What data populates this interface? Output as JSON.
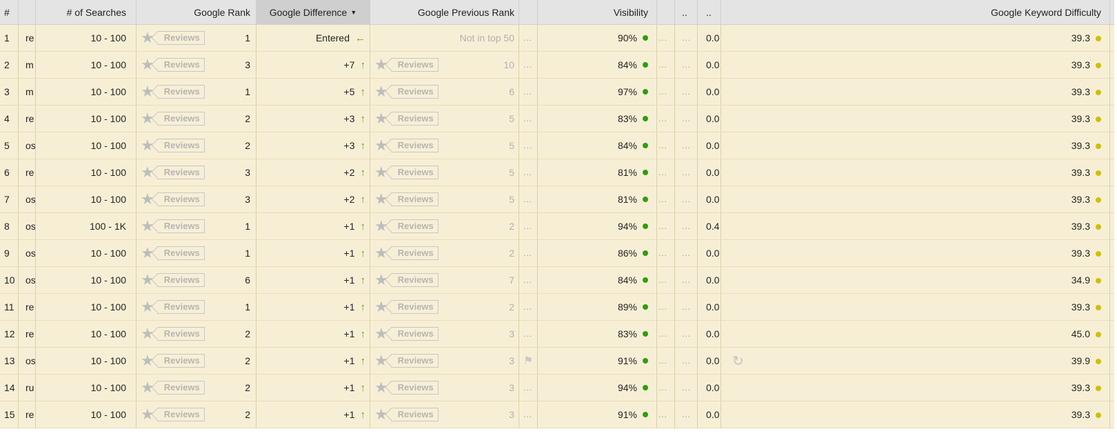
{
  "colors": {
    "green": "#2e9e12",
    "yellow": "#cdbf0c",
    "arrow": "#5aa026"
  },
  "headers": {
    "num": "#",
    "kw": "",
    "searches": "# of Searches",
    "rank": "Google Rank",
    "diff": "Google Difference",
    "prev": "Google Previous Rank",
    "x1": "",
    "vis": "Visibility",
    "x2": "",
    "x3": "..",
    "x4": "..",
    "difficulty": "Google Keyword Difficulty"
  },
  "reviews_label": "Reviews",
  "ellipsis": "...",
  "rows": [
    {
      "num": "1",
      "kw": "re",
      "searches": "10 - 100",
      "rank": "1",
      "diff": "Entered",
      "diff_icon": "arrow-left-icon",
      "prev": "Not in top 50",
      "vis": "90%",
      "vis_color": "green",
      "x4": "0.0",
      "kd": "39.3",
      "kd_color": "yellow"
    },
    {
      "num": "2",
      "kw": "m",
      "searches": "10 - 100",
      "rank": "3",
      "diff": "+7",
      "diff_icon": "arrow-up-icon",
      "prev": "10",
      "vis": "84%",
      "vis_color": "green",
      "x4": "0.0",
      "kd": "39.3",
      "kd_color": "yellow"
    },
    {
      "num": "3",
      "kw": "m",
      "searches": "10 - 100",
      "rank": "1",
      "diff": "+5",
      "diff_icon": "arrow-up-icon",
      "prev": "6",
      "vis": "97%",
      "vis_color": "green",
      "x4": "0.0",
      "kd": "39.3",
      "kd_color": "yellow"
    },
    {
      "num": "4",
      "kw": "re",
      "searches": "10 - 100",
      "rank": "2",
      "diff": "+3",
      "diff_icon": "arrow-up-icon",
      "prev": "5",
      "vis": "83%",
      "vis_color": "green",
      "x4": "0.0",
      "kd": "39.3",
      "kd_color": "yellow"
    },
    {
      "num": "5",
      "kw": "os",
      "searches": "10 - 100",
      "rank": "2",
      "diff": "+3",
      "diff_icon": "arrow-up-icon",
      "prev": "5",
      "vis": "84%",
      "vis_color": "green",
      "x4": "0.0",
      "kd": "39.3",
      "kd_color": "yellow"
    },
    {
      "num": "6",
      "kw": "re",
      "searches": "10 - 100",
      "rank": "3",
      "diff": "+2",
      "diff_icon": "arrow-up-icon",
      "prev": "5",
      "vis": "81%",
      "vis_color": "green",
      "x4": "0.0",
      "kd": "39.3",
      "kd_color": "yellow"
    },
    {
      "num": "7",
      "kw": "os",
      "searches": "10 - 100",
      "rank": "3",
      "diff": "+2",
      "diff_icon": "arrow-up-icon",
      "prev": "5",
      "vis": "81%",
      "vis_color": "green",
      "x4": "0.0",
      "kd": "39.3",
      "kd_color": "yellow"
    },
    {
      "num": "8",
      "kw": "os",
      "searches": "100 - 1K",
      "rank": "1",
      "diff": "+1",
      "diff_icon": "arrow-up-icon",
      "prev": "2",
      "vis": "94%",
      "vis_color": "green",
      "x4": "0.4",
      "kd": "39.3",
      "kd_color": "yellow"
    },
    {
      "num": "9",
      "kw": "os",
      "searches": "10 - 100",
      "rank": "1",
      "diff": "+1",
      "diff_icon": "arrow-up-icon",
      "prev": "2",
      "vis": "86%",
      "vis_color": "green",
      "x4": "0.0",
      "kd": "39.3",
      "kd_color": "yellow"
    },
    {
      "num": "10",
      "kw": "os",
      "searches": "10 - 100",
      "rank": "6",
      "diff": "+1",
      "diff_icon": "arrow-up-icon",
      "prev": "7",
      "vis": "84%",
      "vis_color": "green",
      "x4": "0.0",
      "kd": "34.9",
      "kd_color": "yellow"
    },
    {
      "num": "11",
      "kw": "re",
      "searches": "10 - 100",
      "rank": "1",
      "diff": "+1",
      "diff_icon": "arrow-up-icon",
      "prev": "2",
      "vis": "89%",
      "vis_color": "green",
      "x4": "0.0",
      "kd": "39.3",
      "kd_color": "yellow"
    },
    {
      "num": "12",
      "kw": "re",
      "searches": "10 - 100",
      "rank": "2",
      "diff": "+1",
      "diff_icon": "arrow-up-icon",
      "prev": "3",
      "vis": "83%",
      "vis_color": "green",
      "x4": "0.0",
      "kd": "45.0",
      "kd_color": "yellow"
    },
    {
      "num": "13",
      "kw": "os",
      "searches": "10 - 100",
      "rank": "2",
      "diff": "+1",
      "diff_icon": "arrow-up-icon",
      "prev": "3",
      "vis": "91%",
      "vis_color": "green",
      "x1_icon": "flag-icon",
      "x4": "0.0",
      "x4_icon": "refresh-icon",
      "kd": "39.9",
      "kd_color": "yellow"
    },
    {
      "num": "14",
      "kw": "ru",
      "searches": "10 - 100",
      "rank": "2",
      "diff": "+1",
      "diff_icon": "arrow-up-icon",
      "prev": "3",
      "vis": "94%",
      "vis_color": "green",
      "x4": "0.0",
      "kd": "39.3",
      "kd_color": "yellow"
    },
    {
      "num": "15",
      "kw": "re",
      "searches": "10 - 100",
      "rank": "2",
      "diff": "+1",
      "diff_icon": "arrow-up-icon",
      "prev": "3",
      "vis": "91%",
      "vis_color": "green",
      "x4": "0.0",
      "kd": "39.3",
      "kd_color": "yellow"
    }
  ]
}
